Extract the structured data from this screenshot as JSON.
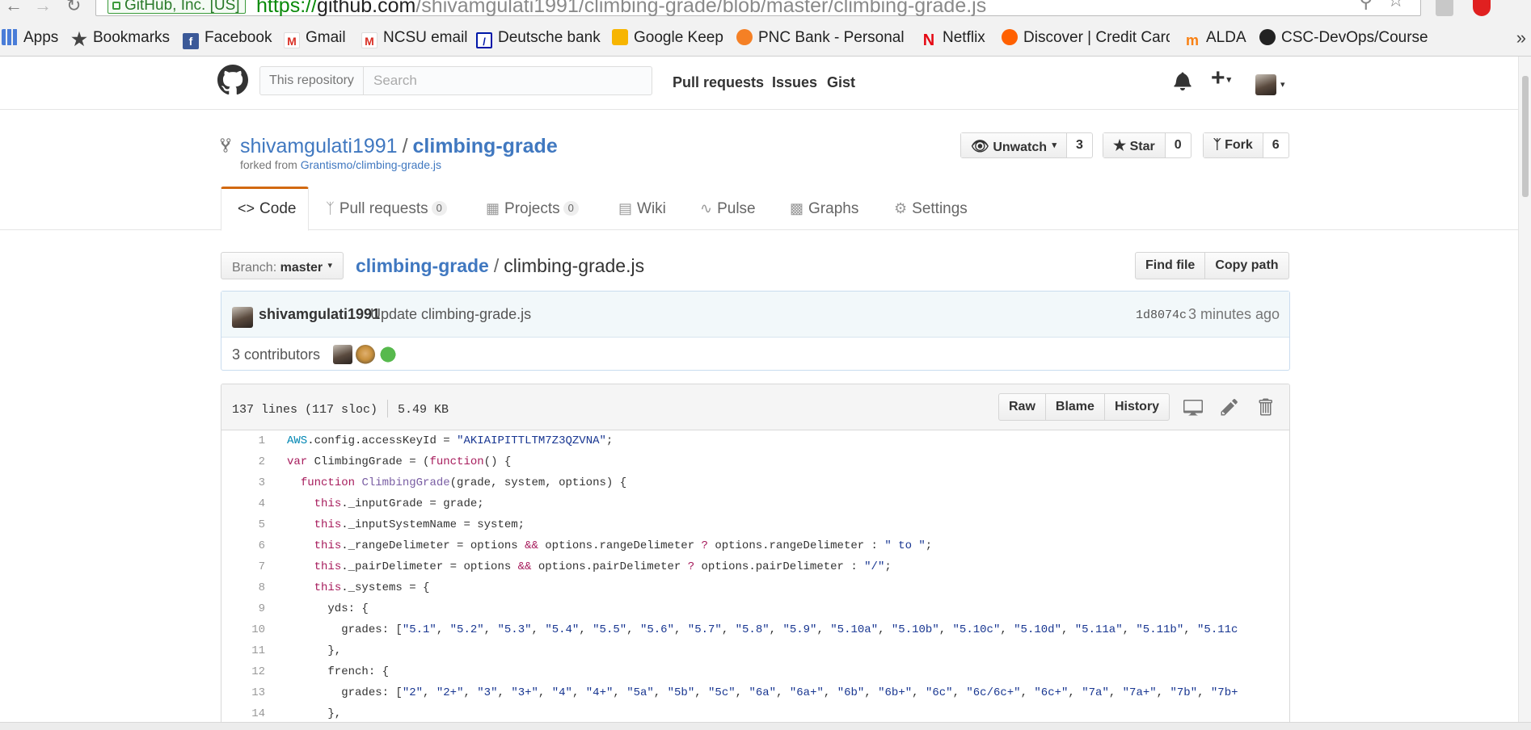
{
  "browser": {
    "ev_badge": "GitHub, Inc. [US]",
    "url_proto": "https://",
    "url_host": "github.com",
    "url_path": "/shivamgulati1991/climbing-grade/blob/master/climbing-grade.js",
    "bookmarks": [
      {
        "label": "Apps",
        "icon": "apps-grid-icon"
      },
      {
        "label": "Bookmarks",
        "icon": "star-icon"
      },
      {
        "label": "Facebook",
        "icon": "facebook-icon"
      },
      {
        "label": "Gmail",
        "icon": "gmail-icon"
      },
      {
        "label": "NCSU email",
        "icon": "gmail-icon"
      },
      {
        "label": "Deutsche bank",
        "icon": "deutsche-bank-icon"
      },
      {
        "label": "Google Keep",
        "icon": "google-keep-icon"
      },
      {
        "label": "PNC Bank - Personal E",
        "icon": "pnc-icon"
      },
      {
        "label": "Netflix",
        "icon": "netflix-icon"
      },
      {
        "label": "Discover | Credit Card",
        "icon": "discover-icon"
      },
      {
        "label": "ALDA",
        "icon": "moodle-icon"
      },
      {
        "label": "CSC-DevOps/Course",
        "icon": "github-icon"
      }
    ],
    "more": "»"
  },
  "header": {
    "scope": "This repository",
    "search_placeholder": "Search",
    "nav": [
      "Pull requests",
      "Issues",
      "Gist"
    ]
  },
  "repo": {
    "owner": "shivamgulati1991",
    "separator": "/",
    "name": "climbing-grade",
    "forked_prefix": "forked from",
    "forked_from": "Grantismo/climbing-grade.js",
    "watch_label": "Unwatch",
    "watch_count": "3",
    "star_label": "Star",
    "star_count": "0",
    "fork_label": "Fork",
    "fork_count": "6"
  },
  "tabs": {
    "code": "Code",
    "pulls": "Pull requests",
    "pulls_count": "0",
    "projects": "Projects",
    "projects_count": "0",
    "wiki": "Wiki",
    "pulse": "Pulse",
    "graphs": "Graphs",
    "settings": "Settings"
  },
  "file": {
    "branch_label": "Branch:",
    "branch": "master",
    "breadcrumb_repo": "climbing-grade",
    "breadcrumb_sep": "/",
    "filename": "climbing-grade.js",
    "find_file": "Find file",
    "copy_path": "Copy path",
    "commit_author": "shivamgulati1991",
    "commit_message": "Update climbing-grade.js",
    "commit_sha": "1d8074c",
    "commit_time": "3 minutes ago",
    "contributors": "3 contributors",
    "lines": "137 lines (117 sloc)",
    "size": "5.49 KB",
    "raw": "Raw",
    "blame": "Blame",
    "history": "History"
  },
  "code_lines": [
    {
      "n": "1",
      "t": "AWS.config.accessKeyId = \"AKIAIPITTLTM7Z3QZVNA\";"
    },
    {
      "n": "2",
      "t": "var ClimbingGrade = (function() {"
    },
    {
      "n": "3",
      "t": "  function ClimbingGrade(grade, system, options) {"
    },
    {
      "n": "4",
      "t": "    this._inputGrade = grade;"
    },
    {
      "n": "5",
      "t": "    this._inputSystemName = system;"
    },
    {
      "n": "6",
      "t": "    this._rangeDelimeter = options && options.rangeDelimeter ? options.rangeDelimeter : \" to \";"
    },
    {
      "n": "7",
      "t": "    this._pairDelimeter = options && options.pairDelimeter ? options.pairDelimeter : \"/\";"
    },
    {
      "n": "8",
      "t": "    this._systems = {"
    },
    {
      "n": "9",
      "t": "      yds: {"
    },
    {
      "n": "10",
      "t": "        grades: [\"5.1\", \"5.2\", \"5.3\", \"5.4\", \"5.5\", \"5.6\", \"5.7\", \"5.8\", \"5.9\", \"5.10a\", \"5.10b\", \"5.10c\", \"5.10d\", \"5.11a\", \"5.11b\", \"5.11c"
    },
    {
      "n": "11",
      "t": "      },"
    },
    {
      "n": "12",
      "t": "      french: {"
    },
    {
      "n": "13",
      "t": "        grades: [\"2\", \"2+\", \"3\", \"3+\", \"4\", \"4+\", \"5a\", \"5b\", \"5c\", \"6a\", \"6a+\", \"6b\", \"6b+\", \"6c\", \"6c/6c+\", \"6c+\", \"7a\", \"7a+\", \"7b\", \"7b+"
    },
    {
      "n": "14",
      "t": "      },"
    }
  ]
}
